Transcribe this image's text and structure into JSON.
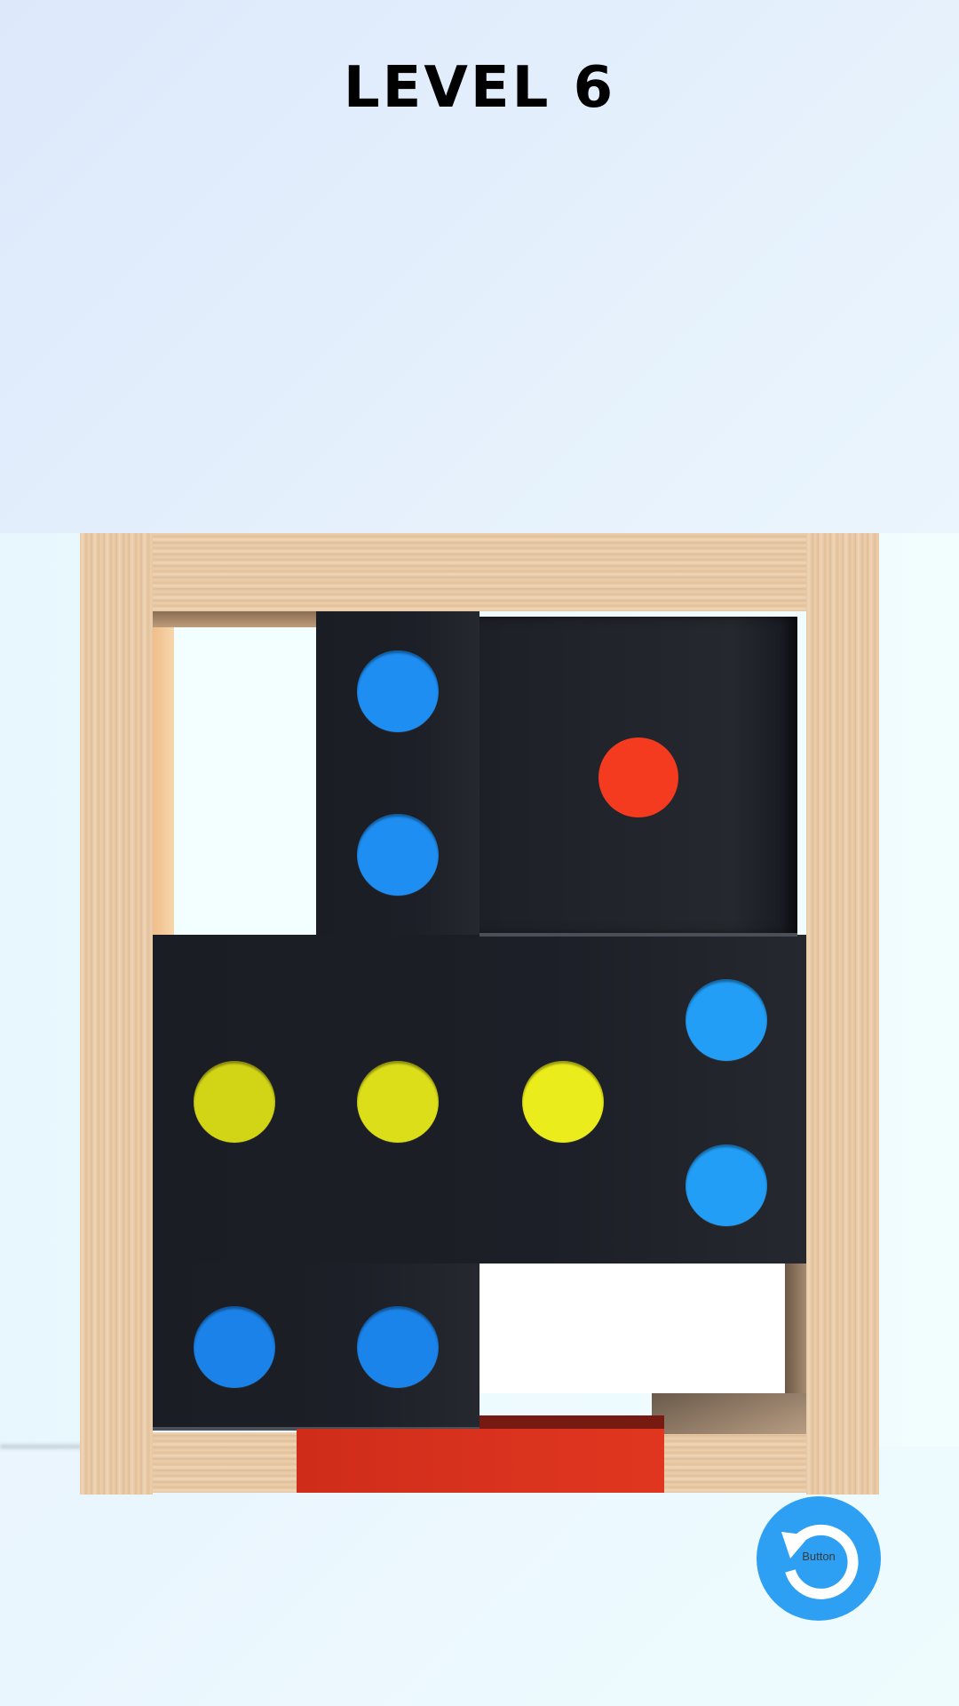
{
  "header": {
    "level_label": "LEVEL 6"
  },
  "colors": {
    "blue": "#1e8ef2",
    "light_blue": "#229ef6",
    "yellow": "#dcde1a",
    "red": "#f43a1f",
    "exit_bar": "#d8321e",
    "button": "#2ea0f3",
    "board_panel": "#1c1f27",
    "wood": "#e6c7a3"
  },
  "balls": [
    {
      "color": "blue"
    },
    {
      "color": "blue"
    },
    {
      "color": "red"
    },
    {
      "color": "light_blue"
    },
    {
      "color": "yellow"
    },
    {
      "color": "yellow"
    },
    {
      "color": "yellow"
    },
    {
      "color": "light_blue"
    },
    {
      "color": "blue"
    },
    {
      "color": "blue"
    }
  ],
  "controls": {
    "reset_button": {
      "label": "Button",
      "icon": "restart-icon"
    }
  }
}
